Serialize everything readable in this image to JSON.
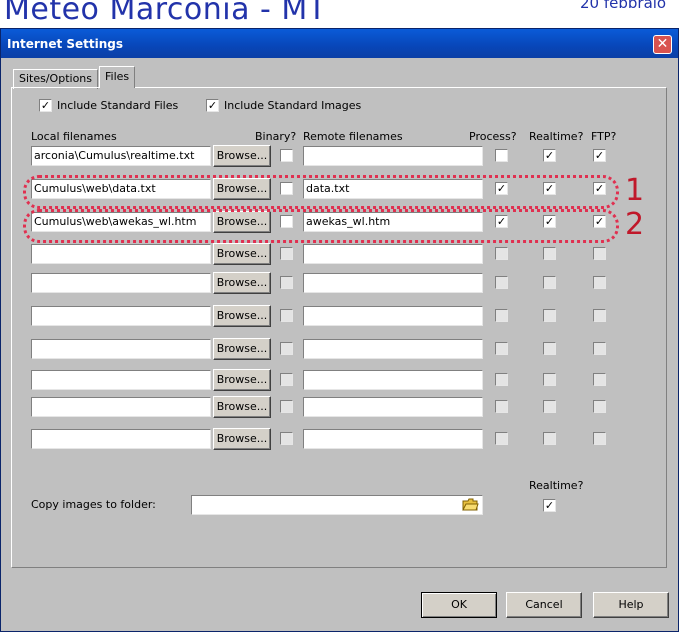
{
  "background": {
    "title": "Meteo Marconia - MT",
    "date": "20 febbraio"
  },
  "window": {
    "title": "Internet Settings",
    "close_icon": "close-icon"
  },
  "tabs": [
    {
      "label": "Sites/Options",
      "active": false
    },
    {
      "label": "Files",
      "active": true
    }
  ],
  "options": {
    "include_standard_files": {
      "label": "Include Standard Files",
      "checked": true
    },
    "include_standard_images": {
      "label": "Include Standard Images",
      "checked": true
    }
  },
  "headers": {
    "local": "Local filenames",
    "binary": "Binary?",
    "remote": "Remote filenames",
    "process": "Process?",
    "realtime": "Realtime?",
    "ftp": "FTP?"
  },
  "browse_label": "Browse...",
  "check_mark": "✓",
  "rows": [
    {
      "local": "arconia\\Cumulus\\realtime.txt",
      "remote": "",
      "binary": false,
      "process": false,
      "realtime": true,
      "ftp": true,
      "enabled": true
    },
    {
      "local": "Cumulus\\web\\data.txt",
      "remote": "data.txt",
      "binary": false,
      "process": true,
      "realtime": true,
      "ftp": true,
      "enabled": true
    },
    {
      "local": "Cumulus\\web\\awekas_wl.htm",
      "remote": "awekas_wl.htm",
      "binary": false,
      "process": true,
      "realtime": true,
      "ftp": true,
      "enabled": true
    },
    {
      "local": "",
      "remote": "",
      "binary": false,
      "process": false,
      "realtime": false,
      "ftp": false,
      "enabled": false
    },
    {
      "local": "",
      "remote": "",
      "binary": false,
      "process": false,
      "realtime": false,
      "ftp": false,
      "enabled": false
    },
    {
      "local": "",
      "remote": "",
      "binary": false,
      "process": false,
      "realtime": false,
      "ftp": false,
      "enabled": false
    },
    {
      "local": "",
      "remote": "",
      "binary": false,
      "process": false,
      "realtime": false,
      "ftp": false,
      "enabled": false
    },
    {
      "local": "",
      "remote": "",
      "binary": false,
      "process": false,
      "realtime": false,
      "ftp": false,
      "enabled": false
    },
    {
      "local": "",
      "remote": "",
      "binary": false,
      "process": false,
      "realtime": false,
      "ftp": false,
      "enabled": false
    },
    {
      "local": "",
      "remote": "",
      "binary": false,
      "process": false,
      "realtime": false,
      "ftp": false,
      "enabled": false
    }
  ],
  "annotations": [
    "1",
    "2"
  ],
  "copy_images": {
    "label": "Copy images to folder:",
    "value": "",
    "folder_icon": "folder-open-icon",
    "realtime_label": "Realtime?",
    "realtime_checked": true
  },
  "buttons": {
    "ok": "OK",
    "cancel": "Cancel",
    "help": "Help"
  },
  "colors": {
    "titlebar": "#0a5bd8",
    "dialog_bg": "#c0c0c0",
    "annotation": "#c0182a"
  }
}
